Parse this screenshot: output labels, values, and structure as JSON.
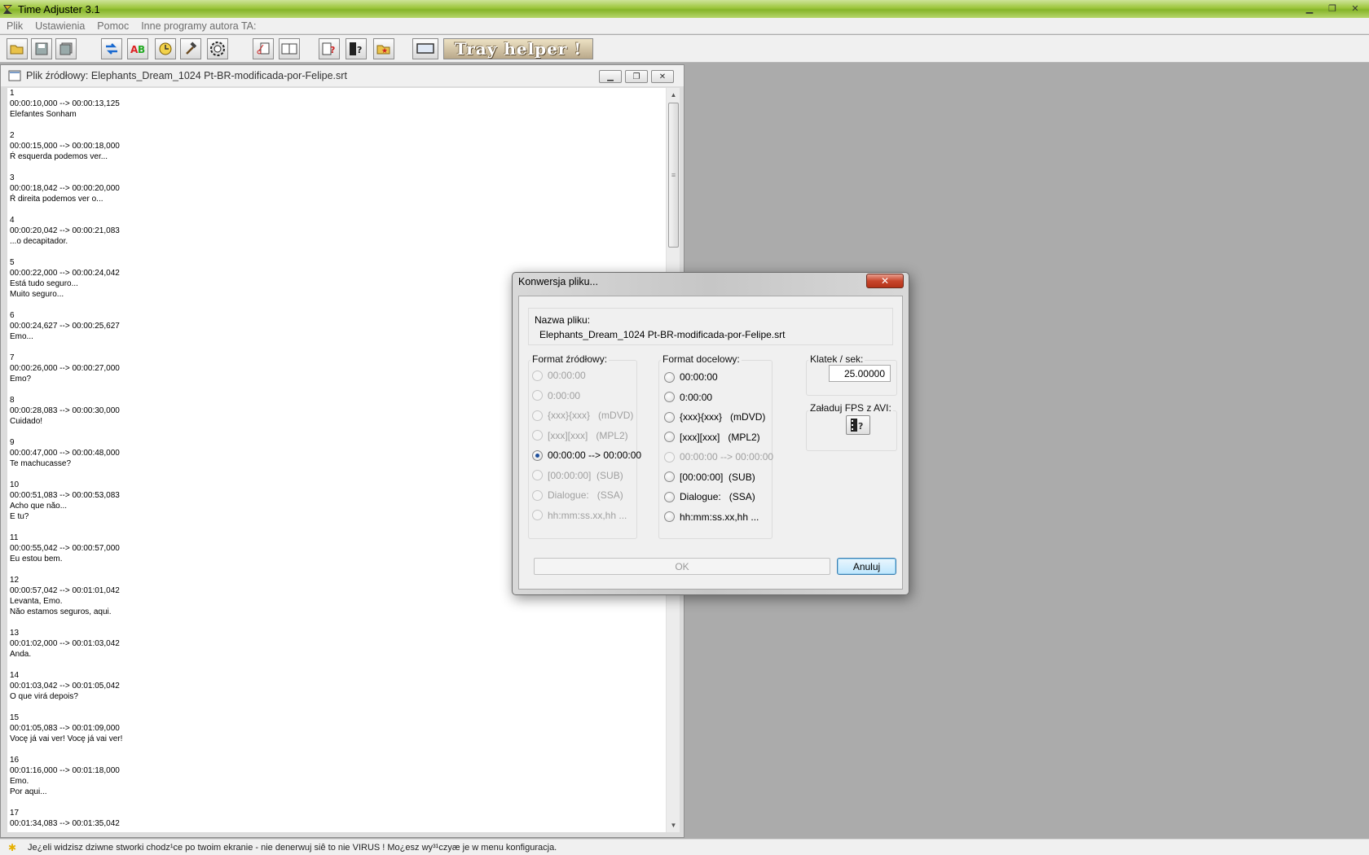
{
  "app": {
    "title": "Time Adjuster 3.1"
  },
  "menu": [
    "Plik",
    "Ustawienia",
    "Pomoc",
    "Inne programy autora TA:"
  ],
  "toolbar": {
    "buttons": [
      "open-folder-icon",
      "save-icon",
      "save-all-icon",
      "convert-arrows-icon",
      "ab-icon",
      "clock-icon",
      "hammer-icon",
      "gear-clock-icon",
      "cut-doc-icon",
      "doc-pair-icon",
      "list-help-icon",
      "film-help-icon",
      "folder-star-icon",
      "monitor-icon"
    ],
    "tray_label": "Tray helper !"
  },
  "child": {
    "title": "Plik źródłowy: Elephants_Dream_1024 Pt-BR-modificada-por-Felipe.srt",
    "subtitles": [
      {
        "n": "1",
        "time": "00:00:10,000 --> 00:00:13,125",
        "lines": [
          "Elefantes Sonham"
        ]
      },
      {
        "n": "2",
        "time": "00:00:15,000 --> 00:00:18,000",
        "lines": [
          "Ŕ esquerda podemos ver..."
        ]
      },
      {
        "n": "3",
        "time": "00:00:18,042 --> 00:00:20,000",
        "lines": [
          "Ŕ direita podemos ver o..."
        ]
      },
      {
        "n": "4",
        "time": "00:00:20,042 --> 00:00:21,083",
        "lines": [
          "...o decapitador."
        ]
      },
      {
        "n": "5",
        "time": "00:00:22,000 --> 00:00:24,042",
        "lines": [
          "Está tudo seguro...",
          "Muito seguro..."
        ]
      },
      {
        "n": "6",
        "time": "00:00:24,627 --> 00:00:25,627",
        "lines": [
          "Emo..."
        ]
      },
      {
        "n": "7",
        "time": "00:00:26,000 --> 00:00:27,000",
        "lines": [
          "Emo?"
        ]
      },
      {
        "n": "8",
        "time": "00:00:28,083 --> 00:00:30,000",
        "lines": [
          "Cuidado!"
        ]
      },
      {
        "n": "9",
        "time": "00:00:47,000 --> 00:00:48,000",
        "lines": [
          "Te machucasse?"
        ]
      },
      {
        "n": "10",
        "time": "00:00:51,083 --> 00:00:53,083",
        "lines": [
          "Acho que năo...",
          "E tu?"
        ]
      },
      {
        "n": "11",
        "time": "00:00:55,042 --> 00:00:57,000",
        "lines": [
          "Eu estou bem."
        ]
      },
      {
        "n": "12",
        "time": "00:00:57,042 --> 00:01:01,042",
        "lines": [
          "Levanta, Emo.",
          "Năo estamos seguros, aqui."
        ]
      },
      {
        "n": "13",
        "time": "00:01:02,000 --> 00:01:03,042",
        "lines": [
          "Anda."
        ]
      },
      {
        "n": "14",
        "time": "00:01:03,042 --> 00:01:05,042",
        "lines": [
          "O que virá depois?"
        ]
      },
      {
        "n": "15",
        "time": "00:01:05,083 --> 00:01:09,000",
        "lines": [
          "Vocę já vai ver! Vocę já vai ver!"
        ]
      },
      {
        "n": "16",
        "time": "00:01:16,000 --> 00:01:18,000",
        "lines": [
          "Emo.",
          "Por aqui..."
        ]
      },
      {
        "n": "17",
        "time": "00:01:34,083 --> 00:01:35,042",
        "lines": []
      }
    ]
  },
  "dialog": {
    "title": "Konwersja pliku...",
    "filename_label": "Nazwa pliku:",
    "filename_value": "Elephants_Dream_1024 Pt-BR-modificada-por-Felipe.srt",
    "source_label": "Format źródłowy:",
    "target_label": "Format docelowy:",
    "fps_label": "Klatek / sek:",
    "fps_value": "25.00000",
    "load_fps_label": "Załaduj FPS z AVI:",
    "source_formats": [
      {
        "label": "00:00:00",
        "checked": false,
        "disabled": true
      },
      {
        "label": "0:00:00",
        "checked": false,
        "disabled": true
      },
      {
        "label": "{xxx}{xxx}   (mDVD)",
        "checked": false,
        "disabled": true
      },
      {
        "label": "[xxx][xxx]   (MPL2)",
        "checked": false,
        "disabled": true
      },
      {
        "label": "00:00:00 --> 00:00:00",
        "checked": true,
        "disabled": false
      },
      {
        "label": "[00:00:00]  (SUB)",
        "checked": false,
        "disabled": true
      },
      {
        "label": "Dialogue:   (SSA)",
        "checked": false,
        "disabled": true
      },
      {
        "label": "hh:mm:ss.xx,hh ...",
        "checked": false,
        "disabled": true
      }
    ],
    "target_formats": [
      {
        "label": "00:00:00",
        "checked": false,
        "disabled": false
      },
      {
        "label": "0:00:00",
        "checked": false,
        "disabled": false
      },
      {
        "label": "{xxx}{xxx}   (mDVD)",
        "checked": false,
        "disabled": false
      },
      {
        "label": "[xxx][xxx]   (MPL2)",
        "checked": false,
        "disabled": false
      },
      {
        "label": "00:00:00 --> 00:00:00",
        "checked": false,
        "disabled": true
      },
      {
        "label": "[00:00:00]  (SUB)",
        "checked": false,
        "disabled": false
      },
      {
        "label": "Dialogue:   (SSA)",
        "checked": false,
        "disabled": false
      },
      {
        "label": "hh:mm:ss.xx,hh ...",
        "checked": false,
        "disabled": false
      }
    ],
    "ok_label": "OK",
    "cancel_label": "Anuluj"
  },
  "status": {
    "text": "Je¿eli widzisz dziwne stworki chodz¹ce po twoim ekranie - nie denerwuj siê to nie VIRUS ! Mo¿esz wy³¹czyæ je w menu konfiguracja."
  }
}
